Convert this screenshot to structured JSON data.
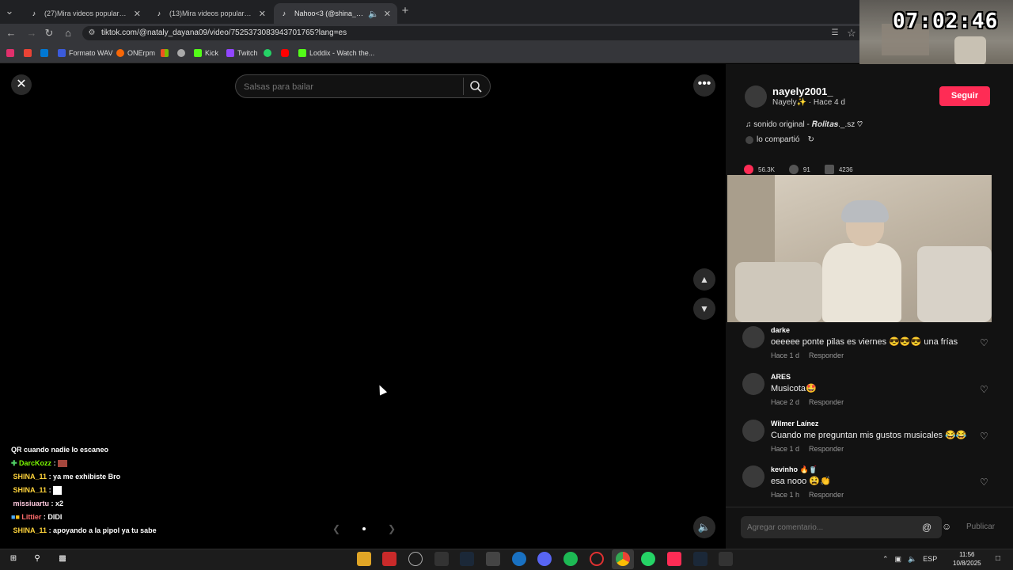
{
  "browser": {
    "tabs": [
      {
        "title": "(27)Mira videos populares sele"
      },
      {
        "title": "(13)Mira videos populares sele"
      },
      {
        "title": "Nahoo<3 (@shina_x_me) |"
      }
    ],
    "url": "tiktok.com/@nataly_dayana09/video/7525373083943701765?lang=es",
    "bookmarks": [
      {
        "label": "Formato WAV",
        "color": "#3b5bdb"
      },
      {
        "label": "ONErpm",
        "color": "#f76707"
      },
      {
        "label": "",
        "color": "#2f9e44"
      },
      {
        "label": "Kick",
        "color": "#53fc18"
      },
      {
        "label": "Twitch",
        "color": "#9146ff"
      },
      {
        "label": "",
        "color": "#25d366"
      },
      {
        "label": "",
        "color": "#ff0000"
      },
      {
        "label": "Loddix - Watch the...",
        "color": "#53fc18"
      }
    ]
  },
  "stream_overlay": {
    "clock": "07:02:46",
    "chat": [
      {
        "user": "QR cuando nadie lo escaneo",
        "msg": "",
        "color": "#ffffff"
      },
      {
        "user": "DarcKozz",
        "msg": ":",
        "color": "#7CFC00"
      },
      {
        "user": "SHINA_11",
        "msg": ": ya me exhibiste Bro",
        "color": "#ffd43b"
      },
      {
        "user": "SHINA_11",
        "msg": ":",
        "color": "#ffd43b"
      },
      {
        "user": "missiuartu",
        "msg": ": x2",
        "color": "#ffc9de"
      },
      {
        "user": "Littier",
        "msg": ": DIDI",
        "color": "#ff6b6b"
      },
      {
        "user": "SHINA_11",
        "msg": ": apoyando a la pipol ya tu sabe",
        "color": "#ffd43b"
      }
    ]
  },
  "video": {
    "search_placeholder": "Salsas para bailar",
    "close_icon": "close-icon",
    "more_icon": "more-icon"
  },
  "panel": {
    "username": "nayely2001_",
    "subline": "Nayely✨ · Hace 4 d",
    "follow_label": "Seguir",
    "sound": "♫  sonido original - 𝑹𝒐𝒍𝒊𝒕𝒂𝒔._.sz ♡",
    "shared": "lo compartió",
    "likes": "56.3K",
    "comments_count": "91",
    "saves": "4236",
    "comments": [
      {
        "user": "darke",
        "text": "oeeeee ponte pilas es viernes 😎😎😎 una frías",
        "time": "Hace 1 d",
        "reply": "Responder"
      },
      {
        "user": "ARES",
        "text": "Musicota🤩",
        "time": "Hace 2 d",
        "reply": "Responder"
      },
      {
        "user": "Wilmer Laínez",
        "text": "Cuando me preguntan mis gustos musicales 😂😂",
        "time": "Hace 1 d",
        "reply": "Responder"
      },
      {
        "user": "kevinho 🔥🥤",
        "text": "esa nooo 😫👏",
        "time": "Hace 1 h",
        "reply": "Responder"
      }
    ],
    "comment_placeholder": "Agregar comentario...",
    "publish_label": "Publicar"
  },
  "taskbar": {
    "lang": "ESP",
    "time": "11:56",
    "date": "10/8/2025"
  }
}
